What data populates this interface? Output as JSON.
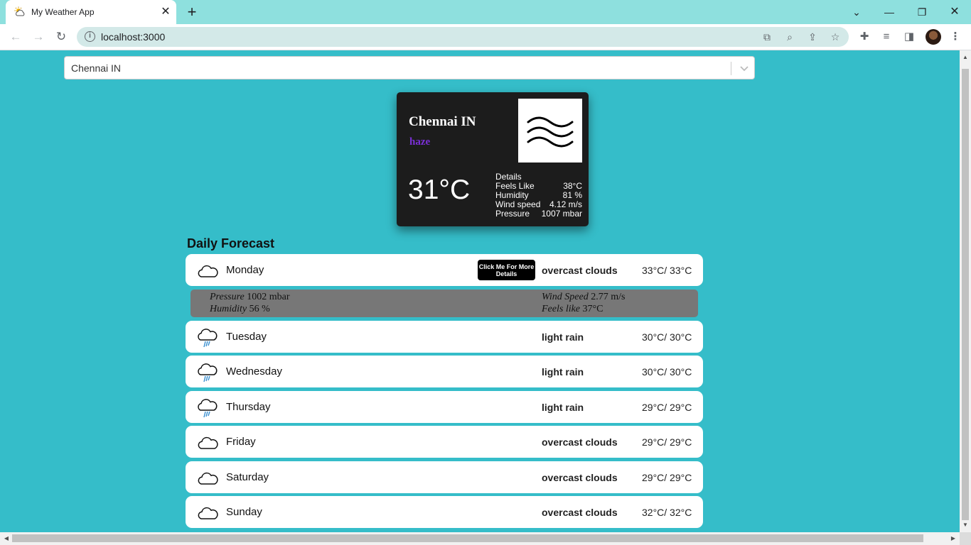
{
  "browser": {
    "tab_title": "My Weather App",
    "tab_close_glyph": "✕",
    "new_tab_glyph": "+",
    "url": "localhost:3000",
    "window_controls": {
      "list": "⌄",
      "minimize": "—",
      "restore": "❐",
      "close": "✕"
    },
    "nav": {
      "back": "←",
      "forward": "→",
      "reload": "↻"
    },
    "icons": [
      "open-in-app-icon",
      "zoom-icon",
      "share-icon",
      "bookmark-star-icon",
      "extensions-icon",
      "media-control-icon",
      "side-panel-icon",
      "profile-avatar",
      "menu-icon"
    ]
  },
  "search": {
    "selected_city": "Chennai IN"
  },
  "current": {
    "city": "Chennai IN",
    "description": "haze",
    "temperature": "31°C",
    "icon": "haze-icon",
    "details_title": "Details",
    "details": [
      {
        "label": "Feels Like",
        "value": "38°C"
      },
      {
        "label": "Humidity",
        "value": "81 %"
      },
      {
        "label": "Wind speed",
        "value": "4.12 m/s"
      },
      {
        "label": "Pressure",
        "value": "1007 mbar"
      }
    ]
  },
  "forecast": {
    "title": "Daily Forecast",
    "more_details_button": "Click Me For More Details",
    "days": [
      {
        "name": "Monday",
        "description": "overcast clouds",
        "temp": "33°C/ 33°C",
        "icon": "cloud-icon"
      },
      {
        "name": "Tuesday",
        "description": "light rain",
        "temp": "30°C/ 30°C",
        "icon": "rain-icon"
      },
      {
        "name": "Wednesday",
        "description": "light rain",
        "temp": "30°C/ 30°C",
        "icon": "rain-icon"
      },
      {
        "name": "Thursday",
        "description": "light rain",
        "temp": "29°C/ 29°C",
        "icon": "rain-icon"
      },
      {
        "name": "Friday",
        "description": "overcast clouds",
        "temp": "29°C/ 29°C",
        "icon": "cloud-icon"
      },
      {
        "name": "Saturday",
        "description": "overcast clouds",
        "temp": "29°C/ 29°C",
        "icon": "cloud-icon"
      },
      {
        "name": "Sunday",
        "description": "overcast clouds",
        "temp": "32°C/ 32°C",
        "icon": "cloud-icon"
      }
    ],
    "expanded": {
      "pressure_label": "Pressure",
      "pressure_value": "1002 mbar",
      "humidity_label": "Humidity",
      "humidity_value": "56 %",
      "wind_label": "Wind Speed",
      "wind_value": "2.77 m/s",
      "feels_label": "Feels like",
      "feels_value": "37°C"
    }
  },
  "colors": {
    "page_background": "#35bdc9",
    "card_background": "#1c1c1c",
    "description_accent": "#7a2fd6",
    "expanded_panel": "#777777"
  }
}
